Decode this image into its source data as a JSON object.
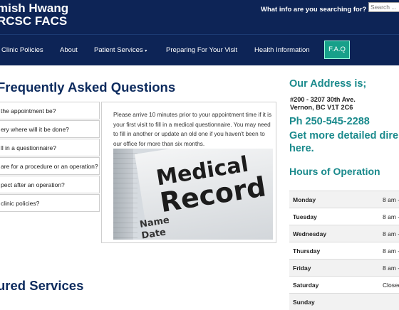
{
  "header": {
    "brand_line1": "mish Hwang",
    "brand_line2": "RCSC FACS",
    "search_label": "What info are you searching for?",
    "search_placeholder": "Search ..."
  },
  "nav": {
    "items": [
      "Clinic Policies",
      "About",
      "Patient Services",
      "Preparing For Your Visit",
      "Health Information"
    ],
    "patient_services_caret": "▾",
    "faq": "F.A.Q"
  },
  "faq": {
    "title": "Frequently Asked Questions",
    "questions": [
      "the appointment be?",
      "ery where will it be done?",
      "ll in a questionnaire?",
      "are for a procedure or an operation?",
      "pect after an operation?",
      "clinic policies?"
    ],
    "answer": "Please arrive 10 minutes prior to your appointment time if it is your first visit to fill in a medical questionnaire. You may need to fill in another or update an old one if you haven't been to our office for more than six months.",
    "image_alt": "Medical Record"
  },
  "featured": {
    "title": "ured Services"
  },
  "sidebar": {
    "address_title": "Our Address is;",
    "address_line1": "#200 - 3207 30th Ave.",
    "address_line2": "Vernon, BC V1T 2C6",
    "phone": "Ph 250-545-2288",
    "details_line1": "Get more detailed dire",
    "details_line2": "here.",
    "hours_title": "Hours of Operation",
    "hours": [
      {
        "day": "Monday",
        "time": "8 am -"
      },
      {
        "day": "Tuesday",
        "time": "8 am -"
      },
      {
        "day": "Wednesday",
        "time": "8 am -"
      },
      {
        "day": "Thursday",
        "time": "8 am -"
      },
      {
        "day": "Friday",
        "time": "8 am -"
      },
      {
        "day": "Saturday",
        "time": "Closed"
      },
      {
        "day": "Sunday",
        "time": ""
      }
    ]
  },
  "colors": {
    "header_bg": "#0d2456",
    "accent_teal": "#1a8a8c",
    "faq_button": "#17a08a",
    "title_navy": "#0d2b5e"
  }
}
